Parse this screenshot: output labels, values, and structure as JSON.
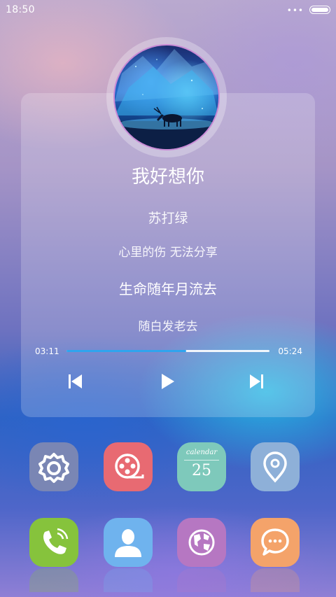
{
  "status_bar": {
    "time": "18:50",
    "signal": "•••"
  },
  "player": {
    "song_title": "我好想你",
    "artist": "苏打绿",
    "lyrics": [
      "心里的伤 无法分享",
      "生命随年月流去",
      "随白发老去"
    ],
    "current_time": "03:11",
    "total_time": "05:24",
    "progress": 0.59,
    "accent_color": "#2fa4ee"
  },
  "apps_row1": [
    {
      "name": "settings",
      "icon": "gear-icon",
      "color": "#7a86b4"
    },
    {
      "name": "video",
      "icon": "film-reel-icon",
      "color": "#e86a72"
    },
    {
      "name": "calendar",
      "icon": "calendar-icon",
      "color": "#7ec9bb",
      "label": "calendar",
      "day": "25"
    },
    {
      "name": "maps",
      "icon": "location-pin-icon",
      "color": "#8eb0d8"
    }
  ],
  "apps_row2": [
    {
      "name": "phone",
      "icon": "phone-icon",
      "color": "#86c33c"
    },
    {
      "name": "contacts",
      "icon": "contact-icon",
      "color": "#6fb3ee"
    },
    {
      "name": "browser",
      "icon": "globe-icon",
      "color": "#b677c2"
    },
    {
      "name": "messages",
      "icon": "chat-icon",
      "color": "#f4a36a"
    }
  ]
}
